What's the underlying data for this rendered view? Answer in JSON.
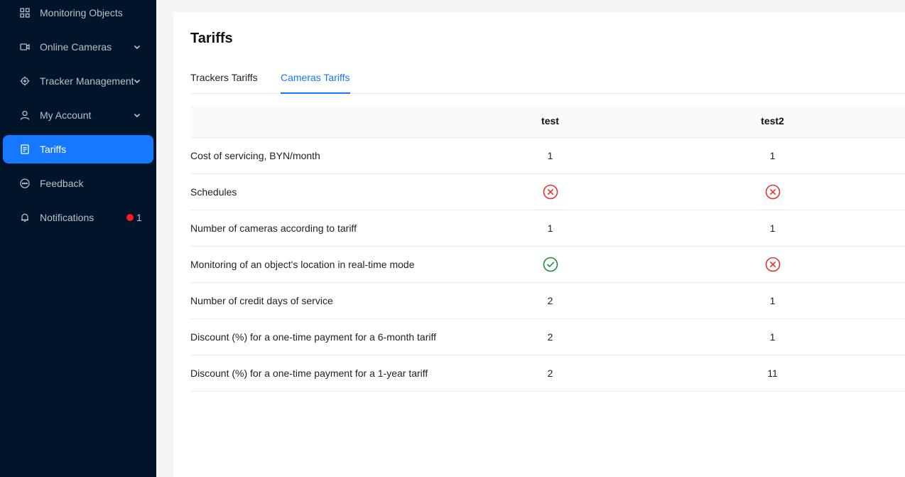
{
  "sidebar": {
    "items": [
      {
        "label": "Monitoring Objects",
        "icon": "grid-icon"
      },
      {
        "label": "Online Cameras",
        "icon": "video-camera-icon",
        "expandable": true
      },
      {
        "label": "Tracker Management",
        "icon": "target-icon",
        "expandable": true
      },
      {
        "label": "My Account",
        "icon": "user-icon",
        "expandable": true
      },
      {
        "label": "Tariffs",
        "icon": "receipt-icon",
        "active": true
      },
      {
        "label": "Feedback",
        "icon": "chat-icon"
      },
      {
        "label": "Notifications",
        "icon": "bell-icon",
        "badge": "1"
      }
    ]
  },
  "page": {
    "title": "Tariffs",
    "tabs": [
      {
        "label": "Trackers Tariffs",
        "active": false
      },
      {
        "label": "Cameras Tariffs",
        "active": true
      }
    ]
  },
  "table": {
    "columns": [
      "",
      "test",
      "test2"
    ],
    "rows": [
      {
        "name": "Cost of servicing, BYN/month",
        "values": [
          "1",
          "1"
        ]
      },
      {
        "name": "Schedules",
        "values": [
          "no",
          "no"
        ]
      },
      {
        "name": "Number of cameras according to tariff",
        "values": [
          "1",
          "1"
        ]
      },
      {
        "name": "Monitoring of an object's location in real-time mode",
        "values": [
          "yes",
          "no"
        ]
      },
      {
        "name": "Number of credit days of service",
        "values": [
          "2",
          "1"
        ]
      },
      {
        "name": "Discount (%) for a one-time payment for a 6-month tariff",
        "values": [
          "2",
          "1"
        ]
      },
      {
        "name": "Discount (%) for a one-time payment for a 1-year tariff",
        "values": [
          "2",
          "11"
        ]
      }
    ]
  },
  "colors": {
    "sidebar_bg": "#001529",
    "accent": "#1677ff",
    "no_red": "#e5302c",
    "yes_green": "#1f8a3c",
    "badge_red": "#ff1a1a"
  }
}
